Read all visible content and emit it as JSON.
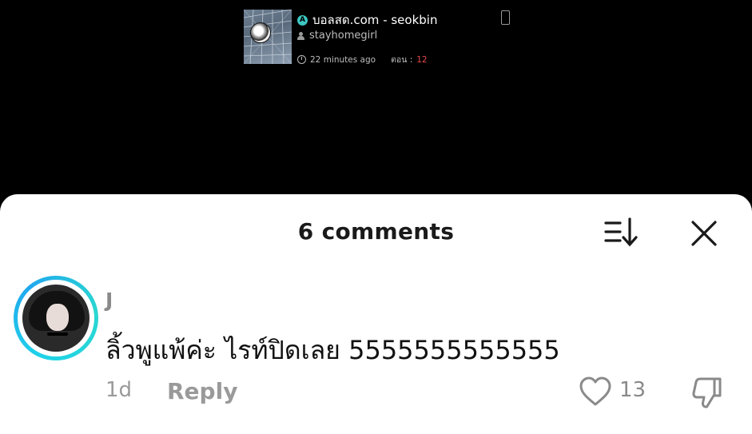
{
  "post": {
    "title": "บอลสด.com - seokbin",
    "badge": "A",
    "username": "stayhomegirl",
    "time": "22 minutes ago",
    "episode_label": "ตอน :",
    "episode_number": "12"
  },
  "comments": {
    "header": "6 comments",
    "items": [
      {
        "name": "J",
        "text": "ลิ้วพูแพ้ค่ะ ไรท์ปิดเลย 5555555555555",
        "age": "1d",
        "reply_label": "Reply",
        "likes": "13"
      }
    ]
  },
  "icons": {
    "sort": "sort-icon",
    "close": "close-icon",
    "like": "heart-icon",
    "dislike": "thumbs-down-icon"
  },
  "colors": {
    "accent_ring": "#1fd3e8",
    "episode_number": "#e84a4a"
  }
}
